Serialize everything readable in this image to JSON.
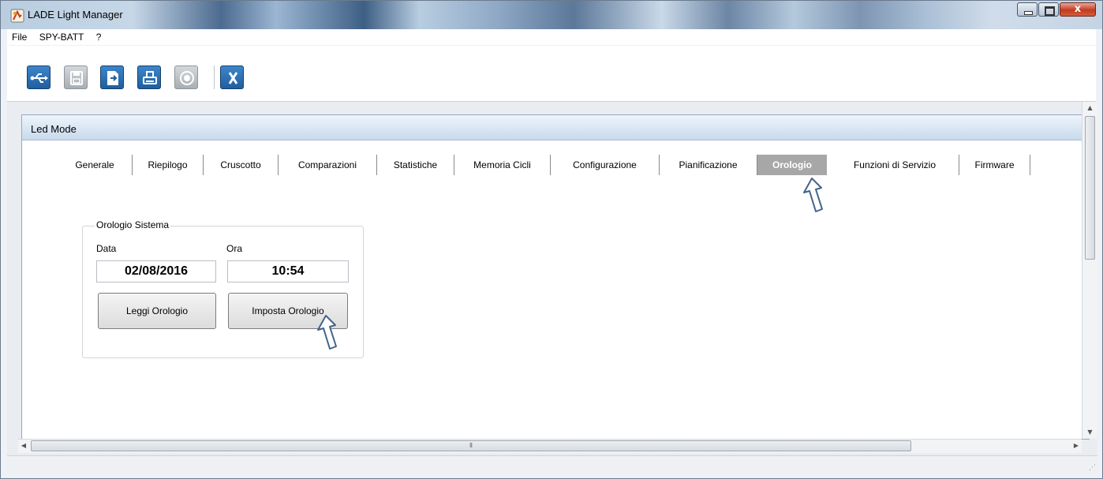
{
  "window": {
    "title": "LADE Light Manager"
  },
  "menu": {
    "items": [
      "File",
      "SPY-BATT",
      "?"
    ]
  },
  "toolbar": {
    "buttons": [
      {
        "icon": "usb-icon"
      },
      {
        "icon": "save-icon"
      },
      {
        "icon": "export-icon"
      },
      {
        "icon": "print-icon"
      },
      {
        "icon": "record-icon"
      },
      {
        "icon": "close-x-icon"
      }
    ]
  },
  "panel": {
    "title": "Led Mode"
  },
  "tabs": [
    "Generale",
    "Riepilogo",
    "Cruscotto",
    "Comparazioni",
    "Statistiche",
    "Memoria Cicli",
    "Configurazione",
    "Pianificazione",
    "Orologio",
    "Funzioni di Servizio",
    "Firmware"
  ],
  "active_tab": "Orologio",
  "clock": {
    "group_title": "Orologio Sistema",
    "date_label": "Data",
    "time_label": "Ora",
    "date_value": "02/08/2016",
    "time_value": "10:54",
    "read_button": "Leggi Orologio",
    "set_button": "Imposta Orologio"
  },
  "colors": {
    "active_tab": "#a7a7a7",
    "toolbar_blue": "#1f5f9e",
    "panel_header": "#c8daec"
  }
}
